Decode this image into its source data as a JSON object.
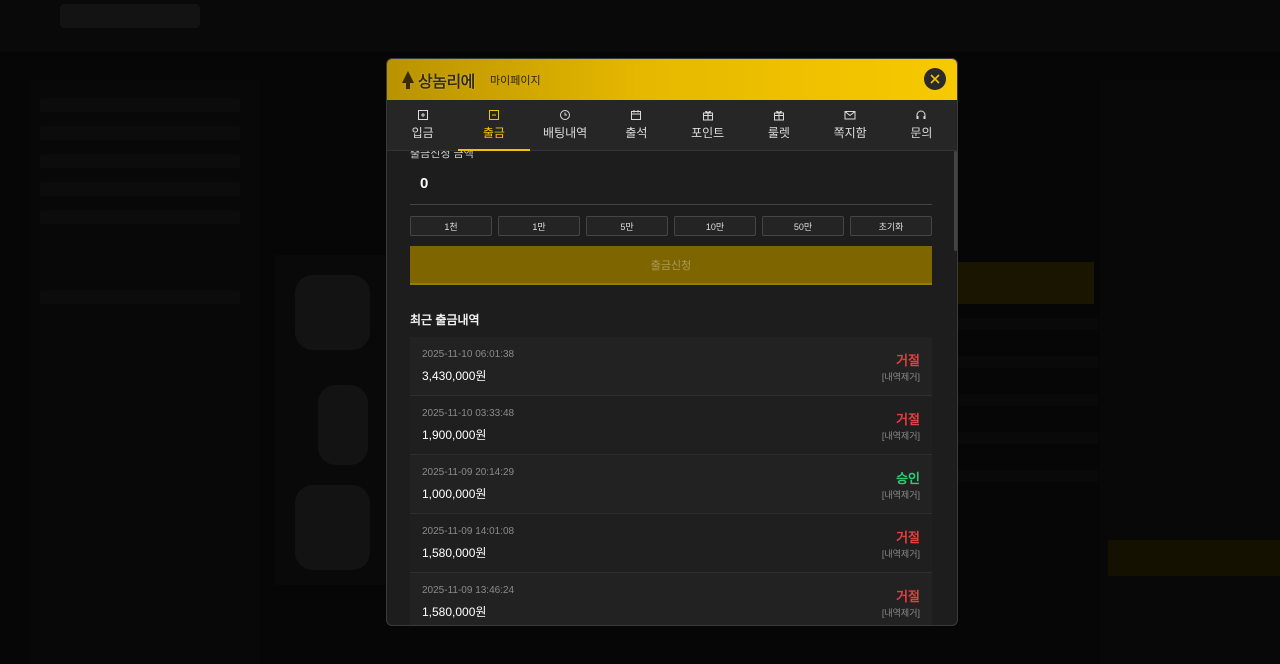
{
  "modal": {
    "brand": "상놈리에",
    "title": "마이페이지",
    "close_icon": "close-icon"
  },
  "tabs": [
    {
      "label": "입금",
      "icon": "deposit-icon"
    },
    {
      "label": "출금",
      "icon": "withdraw-icon",
      "active": true
    },
    {
      "label": "배팅내역",
      "icon": "history-icon"
    },
    {
      "label": "출석",
      "icon": "calendar-icon"
    },
    {
      "label": "포인트",
      "icon": "gift-icon"
    },
    {
      "label": "룰렛",
      "icon": "gift-icon"
    },
    {
      "label": "쪽지함",
      "icon": "mail-icon"
    },
    {
      "label": "문의",
      "icon": "headset-icon"
    }
  ],
  "withdraw": {
    "amount_label": "출금신청 금액",
    "amount_value": "0",
    "quick_amounts": [
      "1천",
      "1만",
      "5만",
      "10만",
      "50만",
      "초기화"
    ],
    "submit_label": "출금신청"
  },
  "history": {
    "title": "최근 출금내역",
    "delete_label": "[내역제거]",
    "rows": [
      {
        "date": "2025-11-10 06:01:38",
        "amount": "3,430,000원",
        "status": "거절"
      },
      {
        "date": "2025-11-10 03:33:48",
        "amount": "1,900,000원",
        "status": "거절"
      },
      {
        "date": "2025-11-09 20:14:29",
        "amount": "1,000,000원",
        "status": "승인"
      },
      {
        "date": "2025-11-09 14:01:08",
        "amount": "1,580,000원",
        "status": "거절"
      },
      {
        "date": "2025-11-09 13:46:24",
        "amount": "1,580,000원",
        "status": "거절"
      }
    ]
  },
  "colors": {
    "accent": "#f2c400",
    "reject": "#e04040",
    "approve": "#2ecc71"
  }
}
